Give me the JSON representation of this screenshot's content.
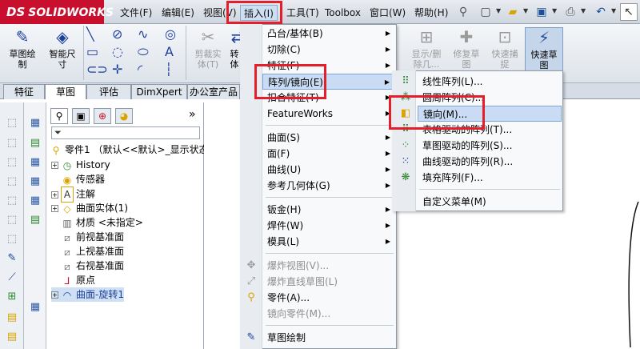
{
  "app": {
    "logo_prefix": "DS",
    "logo_name": "SOLIDWORKS"
  },
  "menubar": [
    {
      "label": "文件(F)"
    },
    {
      "label": "编辑(E)"
    },
    {
      "label": "视图(V)"
    },
    {
      "label": "插入(I)"
    },
    {
      "label": "工具(T)"
    },
    {
      "label": "Toolbox"
    },
    {
      "label": "窗口(W)"
    },
    {
      "label": "帮助(H)"
    }
  ],
  "commands": {
    "sketch": "草图绘\n制",
    "smart_dim": "智能尺\n寸",
    "cut_entities": "剪裁实\n体(T)",
    "convert": "转\n体",
    "show_hide": "显示/删\n除几...",
    "repair_sketch": "修复草\n图",
    "quick_snap": "快速捕\n捉",
    "rapid_sketch": "快速草\n图"
  },
  "tabs": [
    "特征",
    "草图",
    "评估",
    "DimXpert",
    "办公室产品"
  ],
  "tree": {
    "root": "零件1 （默认<<默认>_显示状态",
    "items": [
      "History",
      "传感器",
      "注解",
      "曲面实体(1)",
      "材质 <未指定>",
      "前视基准面",
      "上视基准面",
      "右视基准面",
      "原点",
      "曲面-旋转1"
    ]
  },
  "insert_menu": {
    "items": [
      {
        "label": "凸台/基体(B)",
        "sub": true
      },
      {
        "label": "切除(C)",
        "sub": true
      },
      {
        "label": "特征(F)",
        "sub": true
      },
      {
        "label": "阵列/镜向(E)",
        "sub": true
      },
      {
        "label": "扣合特征(T)",
        "sub": true
      },
      {
        "label": "FeatureWorks",
        "sub": true
      },
      {
        "label": "曲面(S)",
        "sub": true
      },
      {
        "label": "面(F)",
        "sub": true
      },
      {
        "label": "曲线(U)",
        "sub": true
      },
      {
        "label": "参考几何体(G)",
        "sub": true
      },
      {
        "label": "钣金(H)",
        "sub": true
      },
      {
        "label": "焊件(W)",
        "sub": true
      },
      {
        "label": "模具(L)",
        "sub": true
      },
      {
        "label": "爆炸视图(V)..."
      },
      {
        "label": "爆炸直线草图(L)"
      },
      {
        "label": "零件(A)..."
      },
      {
        "label": "镜向零件(M)..."
      },
      {
        "label": "草图绘制"
      }
    ]
  },
  "pattern_submenu": {
    "items": [
      "线性阵列(L)...",
      "圆周阵列(C)...",
      "镜向(M)...",
      "表格驱动的阵列(T)...",
      "草图驱动的阵列(S)...",
      "曲线驱动的阵列(R)...",
      "填充阵列(F)...",
      "自定义菜单(M)"
    ]
  },
  "colors": {
    "highlight_box": "#e41e2b",
    "menu_highlight": "#c9dcf3",
    "brand": "#c8102e"
  }
}
